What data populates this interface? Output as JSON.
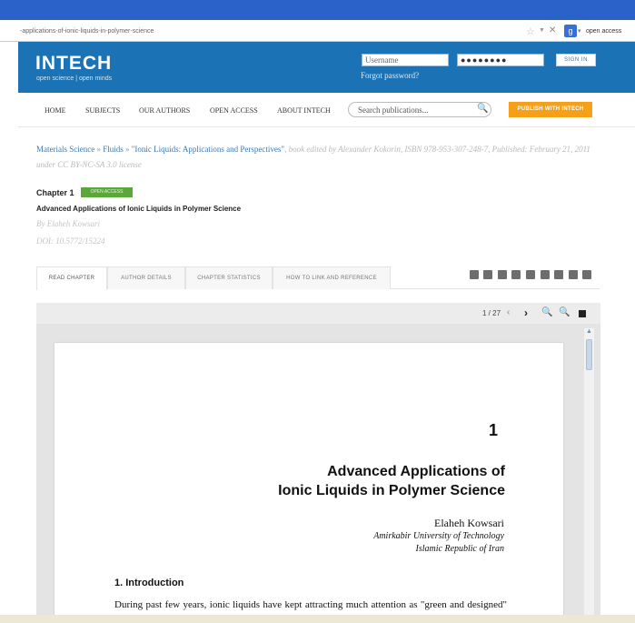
{
  "browser": {
    "url": "-applications-of-ionic-liquids-in-polymer-science",
    "search_engine_letter": "g",
    "search_text": "open access",
    "star_icon": "star-icon",
    "stop_icon": "stop-icon"
  },
  "header": {
    "logo": "INTECH",
    "tagline": "open science | open minds",
    "username_placeholder": "Username",
    "password_value": "●●●●●●●●",
    "forgot_password": "Forgot password?",
    "sign_in": "SIGN IN"
  },
  "nav": {
    "items": [
      {
        "label": "HOME"
      },
      {
        "label": "SUBJECTS"
      },
      {
        "label": "OUR AUTHORS"
      },
      {
        "label": "OPEN ACCESS"
      },
      {
        "label": "ABOUT INTECH"
      }
    ],
    "search_placeholder": "Search publications...",
    "publish_button": "PUBLISH WITH INTECH"
  },
  "breadcrumb": {
    "subject": "Materials Science",
    "subcategory": "Fluids",
    "book": "\"Ionic Liquids: Applications and Perspectives\"",
    "sep1": " » ",
    "sep2": " » ",
    "meta": ", book edited by Alexander Kokorin, ISBN 978-953-307-248-7, Published: February 21, 2011 under CC BY-NC-SA 3.0 license"
  },
  "chapter": {
    "label": "Chapter 1",
    "badge": "OPEN ACCESS",
    "title": "Advanced Applications of Ionic Liquids in Polymer Science",
    "author": "By Elaheh Kowsari",
    "doi": "DOI: 10.5772/15224"
  },
  "tabs": [
    {
      "label": "READ CHAPTER",
      "active": true
    },
    {
      "label": "AUTHOR DETAILS",
      "active": false
    },
    {
      "label": "CHAPTER STATISTICS",
      "active": false
    },
    {
      "label": "HOW TO LINK AND REFERENCE",
      "active": false
    }
  ],
  "share_icons": [
    "facebook-icon",
    "twitter-icon",
    "delicious-icon",
    "digg-icon",
    "stumbleupon-icon",
    "reddit-icon",
    "linkedin-icon",
    "blogger-icon",
    "email-icon"
  ],
  "viewer": {
    "page_counter": "1 / 27",
    "prev_icon": "‹",
    "next_icon": "›"
  },
  "pdf": {
    "chapter_number": "1",
    "title_line1": "Advanced Applications of",
    "title_line2": "Ionic Liquids in Polymer Science",
    "author_name": "Elaheh Kowsari",
    "affiliation_line1": "Amirkabir University of Technology",
    "affiliation_line2": "Islamic Republic of Iran",
    "section_heading": "1. Introduction",
    "body_text": "During past few years, ionic liquids have kept attracting much attention as \"green and designed\" media for chemical reactions. Room temperature ionic liquids have emerged as a"
  }
}
